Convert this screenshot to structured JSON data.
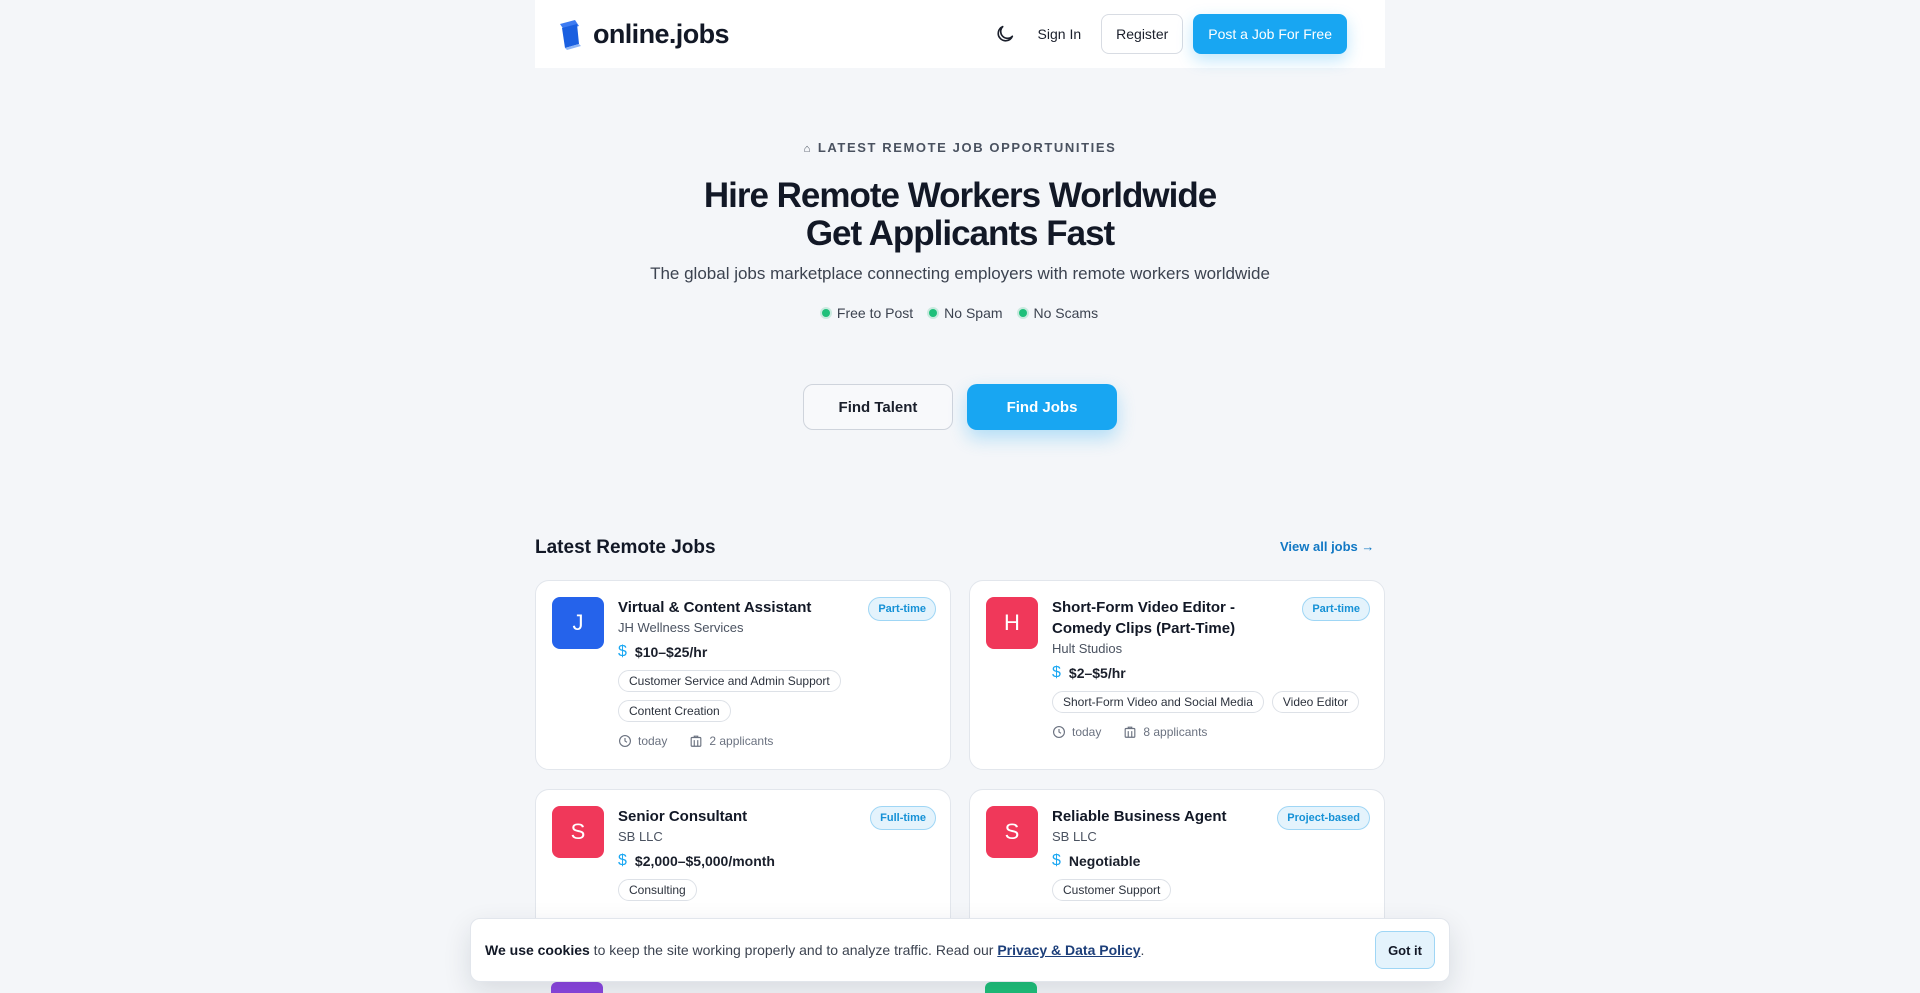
{
  "header": {
    "logo_text": "online.jobs",
    "signin_label": "Sign In",
    "register_label": "Register",
    "post_label": "Post a Job For Free"
  },
  "hero": {
    "eyebrow_glyph": "⌂",
    "eyebrow": "LATEST REMOTE JOB OPPORTUNITIES",
    "title_line1": "Hire Remote Workers Worldwide",
    "title_line2": "Get Applicants Fast",
    "subtitle": "The global jobs marketplace connecting employers with remote workers worldwide",
    "perks": [
      "Free to Post",
      "No Spam",
      "No Scams"
    ],
    "find_talent_label": "Find Talent",
    "find_jobs_label": "Find Jobs"
  },
  "section": {
    "title": "Latest Remote Jobs",
    "view_all": "View all jobs →"
  },
  "jobs": [
    {
      "initial": "J",
      "color": "#2563eb",
      "title": "Virtual & Content Assistant",
      "company": "JH Wellness Services",
      "pay": "$10–$25/hr",
      "tags": [
        "Customer Service and Admin Support",
        "Content Creation"
      ],
      "posted": "today",
      "applicants": "2 applicants",
      "badge": "Part-time"
    },
    {
      "initial": "H",
      "color": "#f0385a",
      "title": "Short-Form Video Editor - Comedy Clips (Part-Time)",
      "company": "Hult Studios",
      "pay": "$2–$5/hr",
      "tags": [
        "Short-Form Video and Social Media",
        "Video Editor"
      ],
      "posted": "today",
      "applicants": "8 applicants",
      "badge": "Part-time"
    },
    {
      "initial": "S",
      "color": "#f0385a",
      "title": "Senior Consultant",
      "company": "SB LLC",
      "pay": "$2,000–$5,000/month",
      "tags": [
        "Consulting"
      ],
      "badge": "Full-time"
    },
    {
      "initial": "S",
      "color": "#f0385a",
      "title": "Reliable Business Agent",
      "company": "SB LLC",
      "pay": "Negotiable",
      "tags": [
        "Customer Support"
      ],
      "badge": "Project-based"
    }
  ],
  "cookie": {
    "lead": "We use cookies",
    "text": " to keep the site working properly and to analyze traffic. Read our ",
    "link": "Privacy & Data Policy",
    "end": ".",
    "button": "Got it"
  },
  "colors": {
    "accent": "#18a6f2",
    "perk_dot": "#1ec07a",
    "peek_left": "#8b46e0",
    "peek_right": "#1ec07a"
  }
}
